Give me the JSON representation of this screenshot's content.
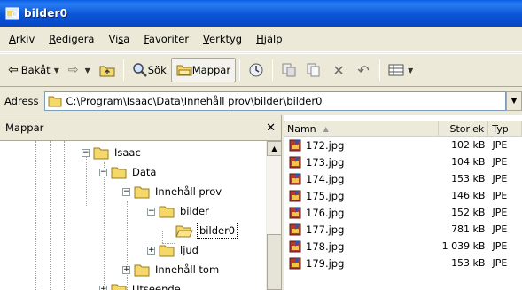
{
  "window": {
    "title": "bilder0"
  },
  "menu": [
    {
      "label": "Arkiv",
      "u": "A",
      "rest": "rkiv"
    },
    {
      "label": "Redigera",
      "u": "R",
      "rest": "edigera"
    },
    {
      "label": "Visa",
      "pre": "Vi",
      "u": "s",
      "rest": "a"
    },
    {
      "label": "Favoriter",
      "u": "F",
      "rest": "avoriter"
    },
    {
      "label": "Verktyg",
      "u": "V",
      "rest": "erktyg"
    },
    {
      "label": "Hjälp",
      "u": "H",
      "rest": "jälp"
    }
  ],
  "toolbar": {
    "back_label": "Bakåt",
    "search_label": "Sök",
    "folders_label": "Mappar"
  },
  "address": {
    "label_pre": "A",
    "label_u": "d",
    "label_rest": "ress",
    "value": "C:\\Program\\Isaac\\Data\\Innehåll prov\\bilder\\bilder0"
  },
  "folders_pane": {
    "title": "Mappar",
    "tree": [
      {
        "label": "Isaac",
        "expander": "−"
      },
      {
        "label": "Data",
        "expander": "−"
      },
      {
        "label": "Innehåll prov",
        "expander": "−"
      },
      {
        "label": "bilder",
        "expander": "−"
      },
      {
        "label": "bilder0",
        "expander": "",
        "selected": true
      },
      {
        "label": "ljud",
        "expander": "+"
      },
      {
        "label": "Innehåll tom",
        "expander": "+"
      },
      {
        "label": "Utseende",
        "expander": "+"
      }
    ]
  },
  "files_pane": {
    "columns": {
      "name": "Namn",
      "size": "Storlek",
      "type": "Typ"
    },
    "files": [
      {
        "name": "172.jpg",
        "size": "102 kB",
        "type": "JPE"
      },
      {
        "name": "173.jpg",
        "size": "104 kB",
        "type": "JPE"
      },
      {
        "name": "174.jpg",
        "size": "153 kB",
        "type": "JPE"
      },
      {
        "name": "175.jpg",
        "size": "146 kB",
        "type": "JPE"
      },
      {
        "name": "176.jpg",
        "size": "152 kB",
        "type": "JPE"
      },
      {
        "name": "177.jpg",
        "size": "781 kB",
        "type": "JPE"
      },
      {
        "name": "178.jpg",
        "size": "1 039 kB",
        "type": "JPE"
      },
      {
        "name": "179.jpg",
        "size": "153 kB",
        "type": "JPE"
      }
    ]
  },
  "colors": {
    "title_bar": "#0B55D8",
    "chrome": "#ECE9D8",
    "folder_yellow": "#F5D86A"
  }
}
